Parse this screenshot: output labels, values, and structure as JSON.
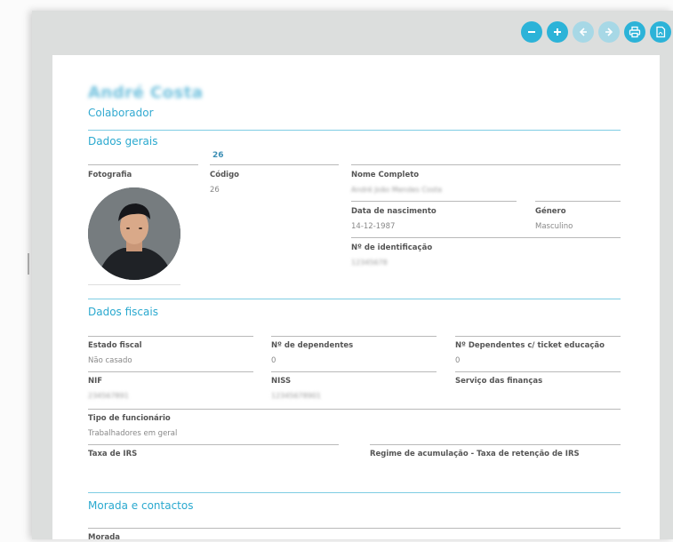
{
  "header": {
    "name": "André Costa",
    "role": "Colaborador"
  },
  "toolbar": {
    "icons": [
      "zoom-out-icon",
      "zoom-in-icon",
      "previous-icon",
      "next-icon",
      "print-icon",
      "pdf-icon"
    ]
  },
  "dados_gerais": {
    "title": "Dados gerais",
    "codigo_top": "26",
    "fotografia_label": "Fotografia",
    "codigo_label": "Código",
    "codigo_value": "26",
    "nome_label": "Nome Completo",
    "nome_value": "André João Mendes Costa",
    "nascimento_label": "Data de nascimento",
    "nascimento_value": "14-12-1987",
    "genero_label": "Género",
    "genero_value": "Masculino",
    "identificacao_label": "Nº de identificação",
    "identificacao_value": "12345678"
  },
  "dados_fiscais": {
    "title": "Dados fiscais",
    "estado_label": "Estado fiscal",
    "estado_value": "Não casado",
    "dependentes_label": "Nº de dependentes",
    "dependentes_value": "0",
    "dep_ticket_label": "Nº Dependentes c/ ticket educação",
    "dep_ticket_value": "0",
    "nif_label": "NIF",
    "nif_value": "234567891",
    "niss_label": "NISS",
    "niss_value": "12345678901",
    "servico_label": "Serviço das finanças",
    "tipo_label": "Tipo de funcionário",
    "tipo_value": "Trabalhadores em geral",
    "taxa_label": "Taxa de IRS",
    "regime_label": "Regime de acumulação - Taxa de retenção de IRS"
  },
  "morada": {
    "title": "Morada e contactos",
    "morada_label": "Morada"
  }
}
